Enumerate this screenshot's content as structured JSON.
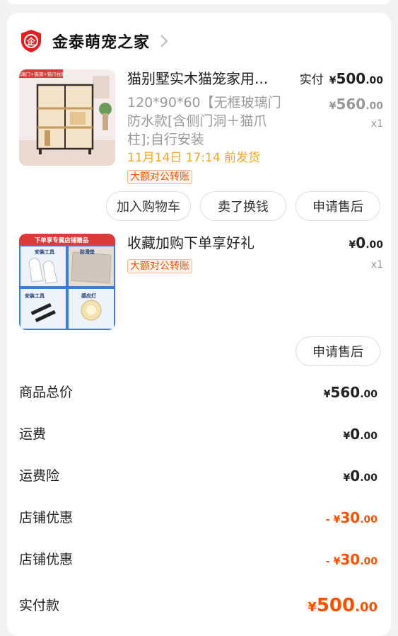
{
  "shop": {
    "name": "金泰萌宠之家",
    "logo_icon": "shop-shield-logo",
    "logo_char": "企"
  },
  "items": [
    {
      "title": "猫别墅实木猫笼家用...",
      "spec": "120*90*60【无框玻璃门防水款[含侧门洞＋猫爪柱];自行安装",
      "ship_time": "11月14日 17:14 前发货",
      "tag": "大额对公转账",
      "paid_label": "实付",
      "paid_yen": "¥",
      "paid_int": "500",
      "paid_dec": ".00",
      "orig_yen": "¥",
      "orig_int": "560",
      "orig_dec": ".00",
      "qty": "x1",
      "thumb_text": "玻璃门+猫洞+猫爪柱款",
      "buttons": [
        "加入购物车",
        "卖了换钱",
        "申请售后"
      ]
    },
    {
      "title": "收藏加购下单享好礼",
      "tag": "大额对公转账",
      "paid_yen": "¥",
      "paid_int": "0",
      "paid_dec": ".00",
      "qty": "x1",
      "thumb_banner": "下单享专属店铺赠品",
      "thumb_labels": [
        "安装工具",
        "防滑垫",
        "安装工具",
        "感应灯"
      ],
      "buttons": [
        "申请售后"
      ]
    }
  ],
  "summary": [
    {
      "label": "商品总价",
      "yen": "¥",
      "int": "560",
      "dec": ".00",
      "prefix": ""
    },
    {
      "label": "运费",
      "yen": "¥",
      "int": "0",
      "dec": ".00",
      "prefix": ""
    },
    {
      "label": "运费险",
      "yen": "¥",
      "int": "0",
      "dec": ".00",
      "prefix": ""
    },
    {
      "label": "店铺优惠",
      "yen": "¥",
      "int": "30",
      "dec": ".00",
      "prefix": "-"
    },
    {
      "label": "店铺优惠",
      "yen": "¥",
      "int": "30",
      "dec": ".00",
      "prefix": "-"
    },
    {
      "label": "实付款",
      "yen": "¥",
      "int": "500",
      "dec": ".00",
      "prefix": ""
    }
  ],
  "colors": {
    "accent": "#ff5000",
    "shipping": "#f5a623",
    "muted": "#999999",
    "logo_red": "#e02020"
  }
}
